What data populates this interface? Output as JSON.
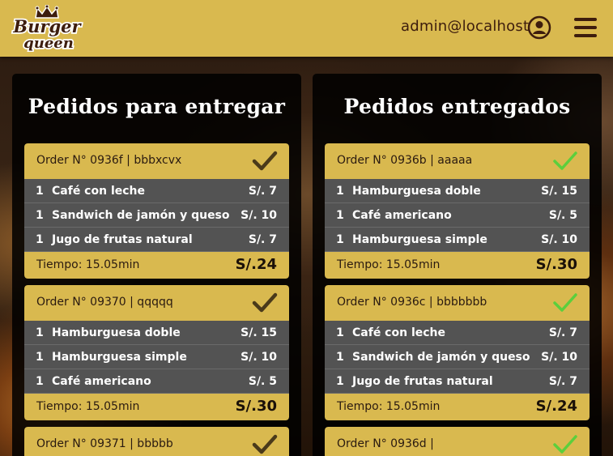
{
  "header": {
    "logo_text_1": "Burger",
    "logo_text_2": "queen",
    "user_email": "admin@localhost"
  },
  "colors": {
    "accent": "#d9b94f",
    "brown": "#3d1d0d",
    "row_bg": "#535353",
    "delivered_check": "#5ccf3c",
    "pending_check": "#4a3a1a"
  },
  "panels": [
    {
      "title": "Pedidos para entregar",
      "check_icon": "check-icon",
      "orders": [
        {
          "header": "Order N° 0936f | bbbxcvx",
          "items": [
            {
              "qty": "1",
              "name": "Café con leche",
              "price": "S/. 7"
            },
            {
              "qty": "1",
              "name": "Sandwich de jamón y queso",
              "price": "S/. 10"
            },
            {
              "qty": "1",
              "name": "Jugo de frutas natural",
              "price": "S/. 7"
            }
          ],
          "time": "Tiempo: 15.05min",
          "total": "S/.24"
        },
        {
          "header": "Order N° 09370 | qqqqq",
          "items": [
            {
              "qty": "1",
              "name": "Hamburguesa doble",
              "price": "S/. 15"
            },
            {
              "qty": "1",
              "name": "Hamburguesa simple",
              "price": "S/. 10"
            },
            {
              "qty": "1",
              "name": "Café americano",
              "price": "S/. 5"
            }
          ],
          "time": "Tiempo: 15.05min",
          "total": "S/.30"
        },
        {
          "header": "Order N° 09371 | bbbbb",
          "items": [],
          "time": "",
          "total": ""
        }
      ]
    },
    {
      "title": "Pedidos entregados",
      "check_icon": "check-icon",
      "orders": [
        {
          "header": "Order N° 0936b | aaaaa",
          "items": [
            {
              "qty": "1",
              "name": "Hamburguesa doble",
              "price": "S/. 15"
            },
            {
              "qty": "1",
              "name": "Café americano",
              "price": "S/. 5"
            },
            {
              "qty": "1",
              "name": "Hamburguesa simple",
              "price": "S/. 10"
            }
          ],
          "time": "Tiempo: 15.05min",
          "total": "S/.30"
        },
        {
          "header": "Order N° 0936c | bbbbbbb",
          "items": [
            {
              "qty": "1",
              "name": "Café con leche",
              "price": "S/. 7"
            },
            {
              "qty": "1",
              "name": "Sandwich de jamón y queso",
              "price": "S/. 10"
            },
            {
              "qty": "1",
              "name": "Jugo de frutas natural",
              "price": "S/. 7"
            }
          ],
          "time": "Tiempo: 15.05min",
          "total": "S/.24"
        },
        {
          "header": "Order N° 0936d | ",
          "items": [],
          "time": "",
          "total": ""
        }
      ]
    }
  ]
}
